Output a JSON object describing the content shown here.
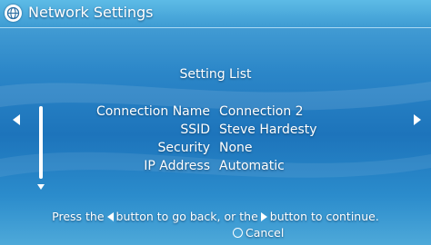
{
  "header": {
    "title": "Network Settings",
    "icon": "network-globe-icon"
  },
  "main": {
    "list_title": "Setting List",
    "rows": [
      {
        "label": "Connection Name",
        "value": "Connection 2"
      },
      {
        "label": "SSID",
        "value": "Steve Hardesty"
      },
      {
        "label": "Security",
        "value": "None"
      },
      {
        "label": "IP Address",
        "value": "Automatic"
      }
    ]
  },
  "footer": {
    "hint_part1": "Press the",
    "hint_part2": "button to go back, or the",
    "hint_part3": "button to continue.",
    "cancel_label": "Cancel"
  },
  "colors": {
    "background": "#2b86c8",
    "text": "#ffffff"
  }
}
